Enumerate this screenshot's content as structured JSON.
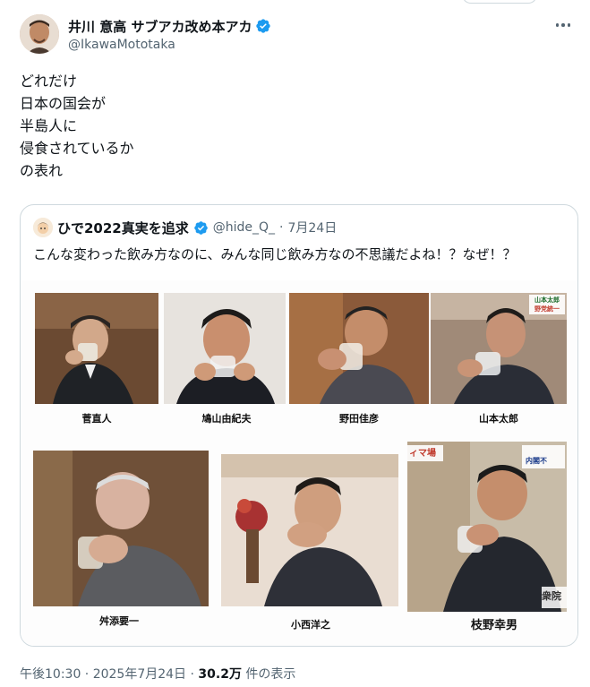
{
  "author": {
    "display_name": "井川 意高 サブアカ改め本アカ",
    "handle": "@IkawaMototaka"
  },
  "tweet": {
    "lines": [
      "どれだけ",
      "日本の国会が",
      "半島人に",
      "侵食されているか",
      "の表れ"
    ]
  },
  "quote": {
    "display_name": "ひで2022真実を追求",
    "handle": "@hide_Q_",
    "separator": "·",
    "date": "7月24日",
    "text": "こんな変わった飲み方なのに、みんな同じ飲み方なの不思議だよね！？なぜ！？",
    "captions": [
      "菅直人",
      "鳩山由紀夫",
      "野田佳彦",
      "山本太郎",
      "舛添要一",
      "小西洋之",
      "枝野幸男"
    ],
    "overlay_tags": [
      "山本太郎",
      "野党統一",
      "内閣不",
      "ィマ場",
      "衆院"
    ]
  },
  "footer": {
    "time": "午後10:30 · 2025年7月24日 · ",
    "views": "30.2万",
    "views_suffix": " 件の表示"
  },
  "colors": {
    "verified": "#1d9bf0",
    "secondary_text": "#536471",
    "border": "#cfd9de"
  }
}
